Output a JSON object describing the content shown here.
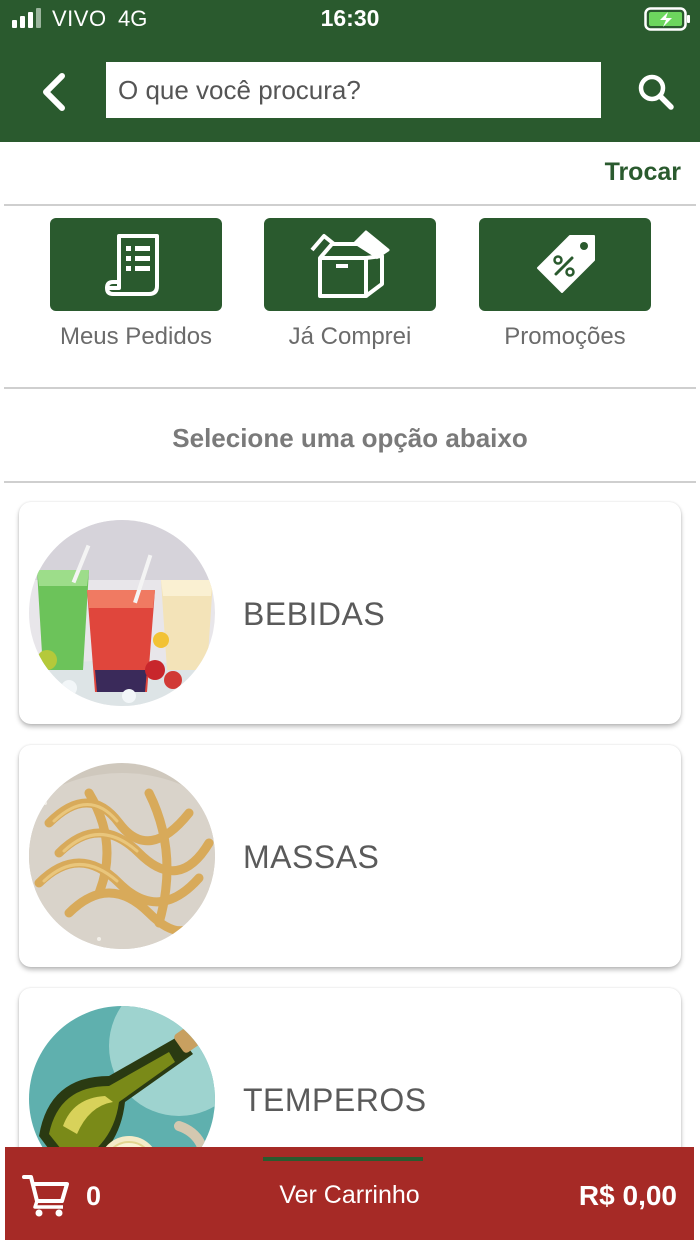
{
  "status_bar": {
    "carrier": "VIVO",
    "network": "4G",
    "time": "16:30"
  },
  "header": {
    "search_placeholder": "O que você procura?",
    "back_icon": "chevron-left-icon",
    "search_icon": "search-icon"
  },
  "store": {
    "change_label": "Trocar"
  },
  "shortcuts": [
    {
      "label": "Meus Pedidos",
      "icon": "receipt-icon"
    },
    {
      "label": "Já Comprei",
      "icon": "open-box-icon"
    },
    {
      "label": "Promoções",
      "icon": "discount-tag-icon"
    }
  ],
  "section": {
    "title": "Selecione uma opção abaixo"
  },
  "categories": [
    {
      "name": "BEBIDAS"
    },
    {
      "name": "MASSAS"
    },
    {
      "name": "TEMPEROS"
    }
  ],
  "cart": {
    "count": "0",
    "label": "Ver Carrinho",
    "total": "R$ 0,00"
  },
  "colors": {
    "primary_green": "#2a5a2e",
    "cart_red": "#a62a26",
    "text_gray": "#6b6b6b"
  }
}
